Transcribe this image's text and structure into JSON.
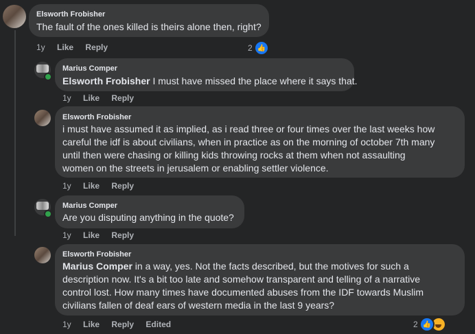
{
  "comments": [
    {
      "author": "Elsworth Frobisher",
      "text": "The fault of the ones killed is theirs alone then, right?",
      "time": "1y",
      "like": "Like",
      "reply": "Reply",
      "reaction_count": "2"
    },
    {
      "author": "Marius Comper",
      "mention": "Elsworth Frobisher",
      "text": " I must have missed the place where it says that.",
      "time": "1y",
      "like": "Like",
      "reply": "Reply"
    },
    {
      "author": "Elsworth Frobisher",
      "lines": [
        "i must have assumed it as implied, as i read three or four times over the last weeks how",
        "careful the idf is about civilians, when in practice as on the morning of october 7th many",
        "until then were chasing or killing kids throwing rocks at them when not assaulting",
        "women on the streets in jerusalem or enabling settler violence."
      ],
      "time": "1y",
      "like": "Like",
      "reply": "Reply"
    },
    {
      "author": "Marius Comper",
      "text": "Are you disputing anything in the quote?",
      "time": "1y",
      "like": "Like",
      "reply": "Reply"
    },
    {
      "author": "Elsworth Frobisher",
      "mention": "Marius Comper",
      "line1_rest": " in a way, yes. Not the facts described, but the motives for such a",
      "lines": [
        "description now. It's a bit too late and somehow transparent and telling of a narrative",
        "control lost. How many times have documented abuses from the IDF towards Muslim",
        "civilians fallen of deaf ears of western media in the last 9 years?"
      ],
      "time": "1y",
      "like": "Like",
      "reply": "Reply",
      "edited": "Edited",
      "reaction_count": "2"
    }
  ],
  "colors": {
    "background": "#242526",
    "bubble": "#3a3b3c",
    "like_blue": "#1877f2",
    "online_green": "#31a24c"
  },
  "icons": [
    "like-reaction-icon",
    "haha-reaction-icon",
    "online-status-icon"
  ]
}
